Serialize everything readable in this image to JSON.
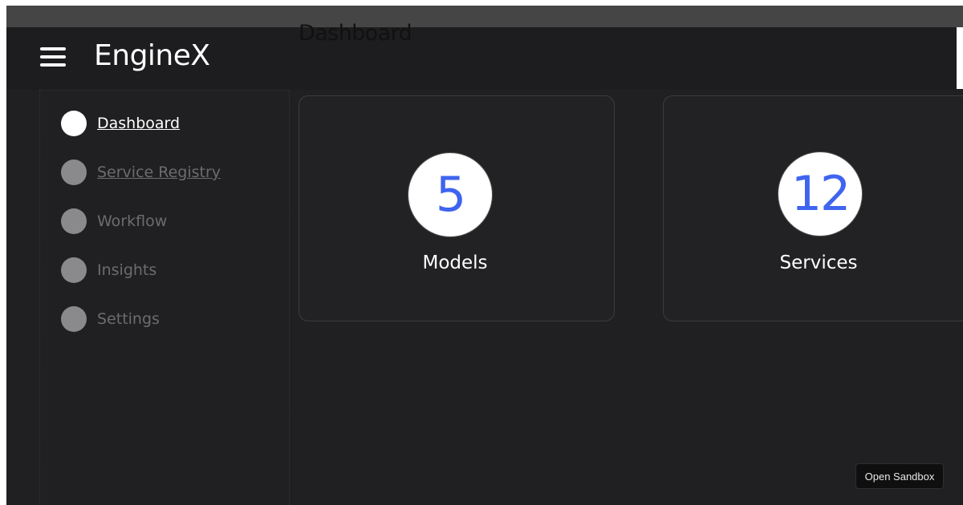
{
  "app": {
    "brand": "EngineX",
    "page_title": "Dashboard"
  },
  "sidebar": {
    "items": [
      {
        "label": "Dashboard",
        "icon": "circle-icon",
        "active": true
      },
      {
        "label": "Service Registry",
        "icon": "circle-icon",
        "active": false
      },
      {
        "label": "Workflow",
        "icon": "circle-icon",
        "active": false
      },
      {
        "label": "Insights",
        "icon": "circle-icon",
        "active": false
      },
      {
        "label": "Settings",
        "icon": "circle-icon",
        "active": false
      }
    ]
  },
  "cards": [
    {
      "value": "5",
      "label": "Models"
    },
    {
      "value": "12",
      "label": "Services"
    }
  ],
  "sandbox": {
    "label": "Open Sandbox"
  },
  "colors": {
    "background": "#202022",
    "accent": "#3f64f0",
    "text": "#ffffff",
    "muted": "#6c6c6e"
  }
}
